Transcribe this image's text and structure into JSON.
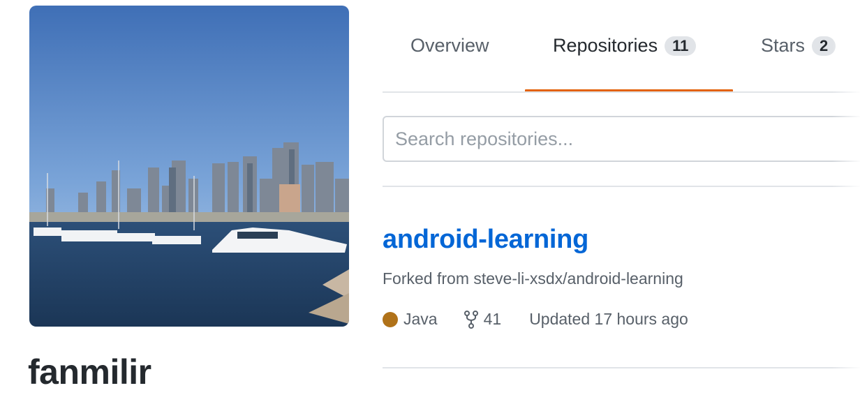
{
  "profile": {
    "username": "fanmilir"
  },
  "tabs": [
    {
      "label": "Overview"
    },
    {
      "label": "Repositories",
      "count": "11",
      "selected": true
    },
    {
      "label": "Stars",
      "count": "2"
    }
  ],
  "search": {
    "placeholder": "Search repositories..."
  },
  "repo": {
    "name": "android-learning",
    "fork_note": "Forked from steve-li-xsdx/android-learning",
    "language": "Java",
    "language_color": "#b07219",
    "forks": "41",
    "updated": "Updated 17 hours ago"
  },
  "colors": {
    "accent_underline": "#e36209",
    "link": "#0366d6"
  },
  "icons": {
    "fork": "repo-forked-icon"
  }
}
